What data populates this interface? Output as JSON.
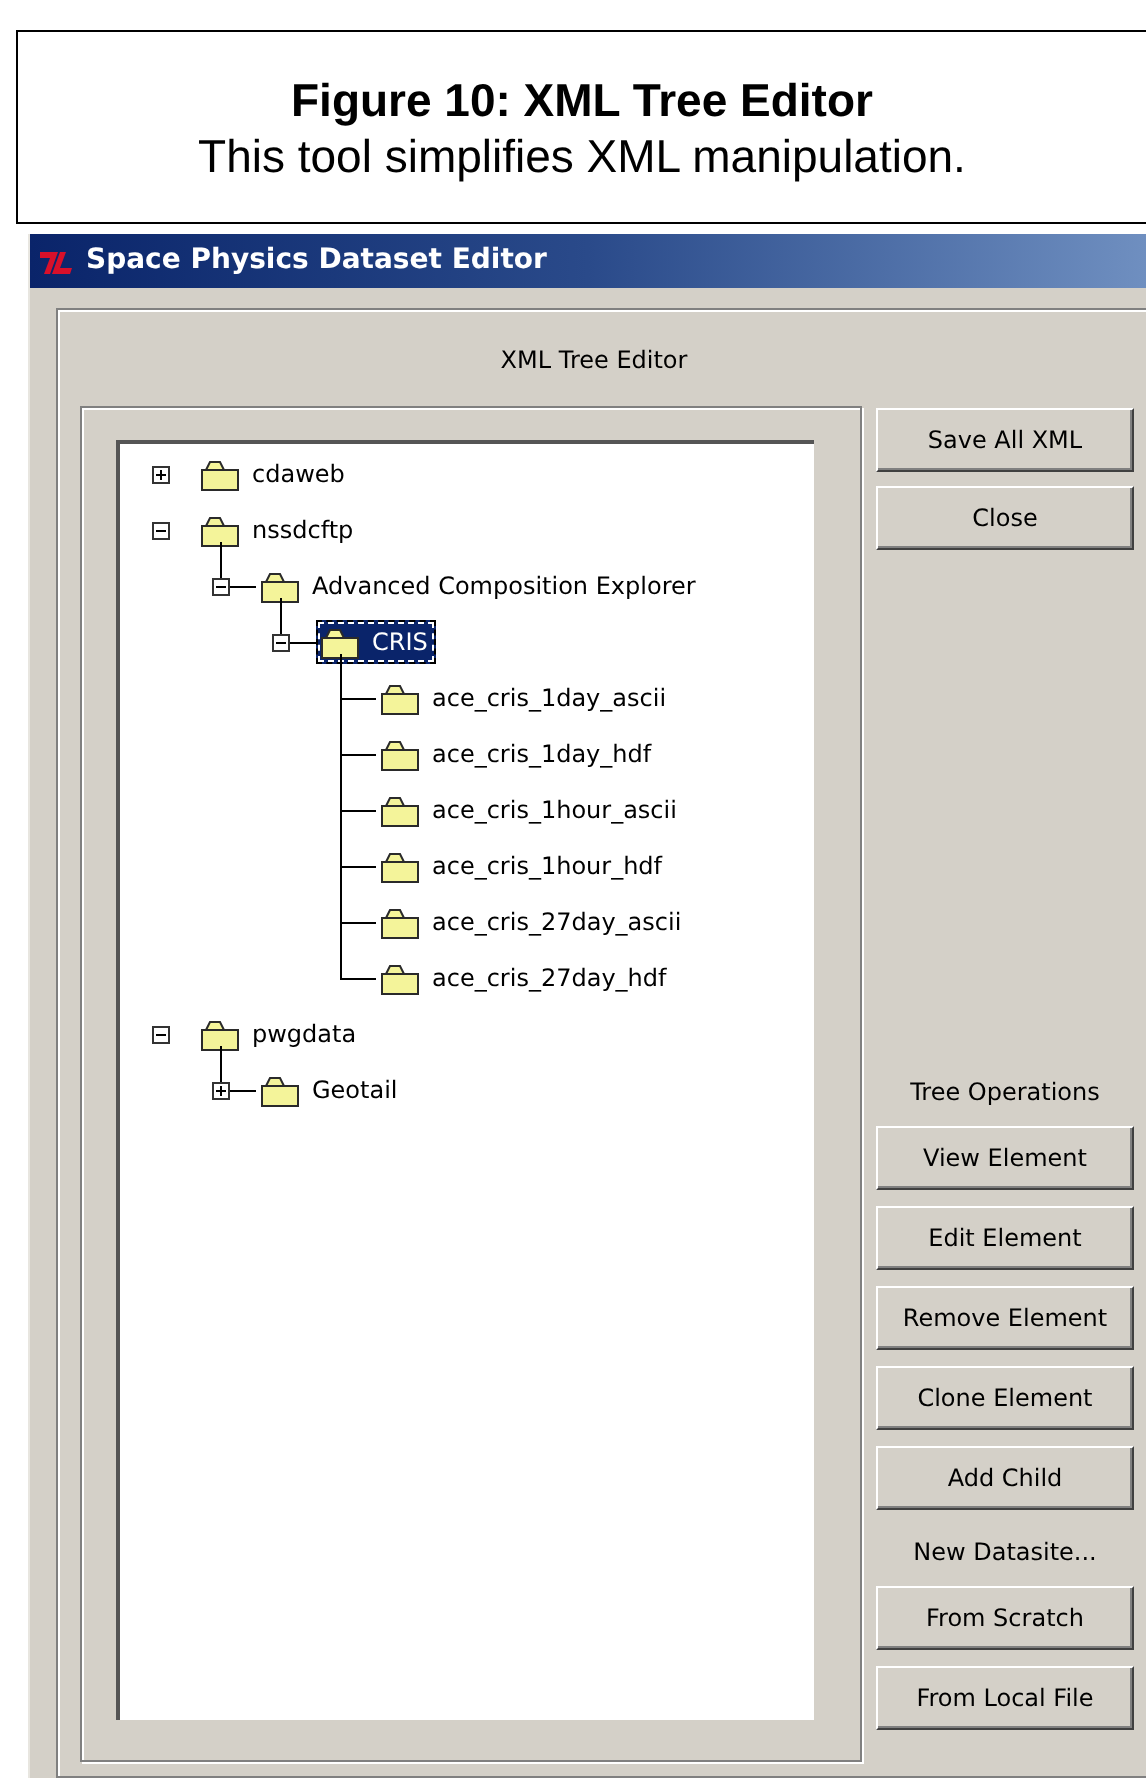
{
  "caption": {
    "title": "Figure 10: XML Tree Editor",
    "text": "This tool simplifies XML manipulation."
  },
  "window": {
    "title": "Space Physics Dataset Editor"
  },
  "panel": {
    "title": "XML Tree Editor"
  },
  "tree": [
    {
      "label": "cdaweb",
      "expanded": false,
      "selected": false
    },
    {
      "label": "nssdcftp",
      "expanded": true,
      "selected": false,
      "children": [
        {
          "label": "Advanced Composition Explorer",
          "expanded": true,
          "selected": false,
          "children": [
            {
              "label": "CRIS",
              "expanded": true,
              "selected": true,
              "children": [
                {
                  "label": "ace_cris_1day_ascii",
                  "selected": false
                },
                {
                  "label": "ace_cris_1day_hdf",
                  "selected": false
                },
                {
                  "label": "ace_cris_1hour_ascii",
                  "selected": false
                },
                {
                  "label": "ace_cris_1hour_hdf",
                  "selected": false
                },
                {
                  "label": "ace_cris_27day_ascii",
                  "selected": false
                },
                {
                  "label": "ace_cris_27day_hdf",
                  "selected": false
                }
              ]
            }
          ]
        }
      ]
    },
    {
      "label": "pwgdata",
      "expanded": true,
      "selected": false,
      "children": [
        {
          "label": "Geotail",
          "expanded": false,
          "selected": false
        }
      ]
    }
  ],
  "top_buttons": [
    "Save All XML",
    "Close"
  ],
  "side_items": [
    {
      "kind": "heading",
      "label": "Tree Operations"
    },
    {
      "kind": "button",
      "label": "View Element"
    },
    {
      "kind": "button",
      "label": "Edit Element"
    },
    {
      "kind": "button",
      "label": "Remove Element"
    },
    {
      "kind": "button",
      "label": "Clone Element"
    },
    {
      "kind": "button",
      "label": "Add Child"
    },
    {
      "kind": "heading",
      "label": "New Datasite..."
    },
    {
      "kind": "button",
      "label": "From Scratch"
    },
    {
      "kind": "button",
      "label": "From Local File"
    }
  ]
}
